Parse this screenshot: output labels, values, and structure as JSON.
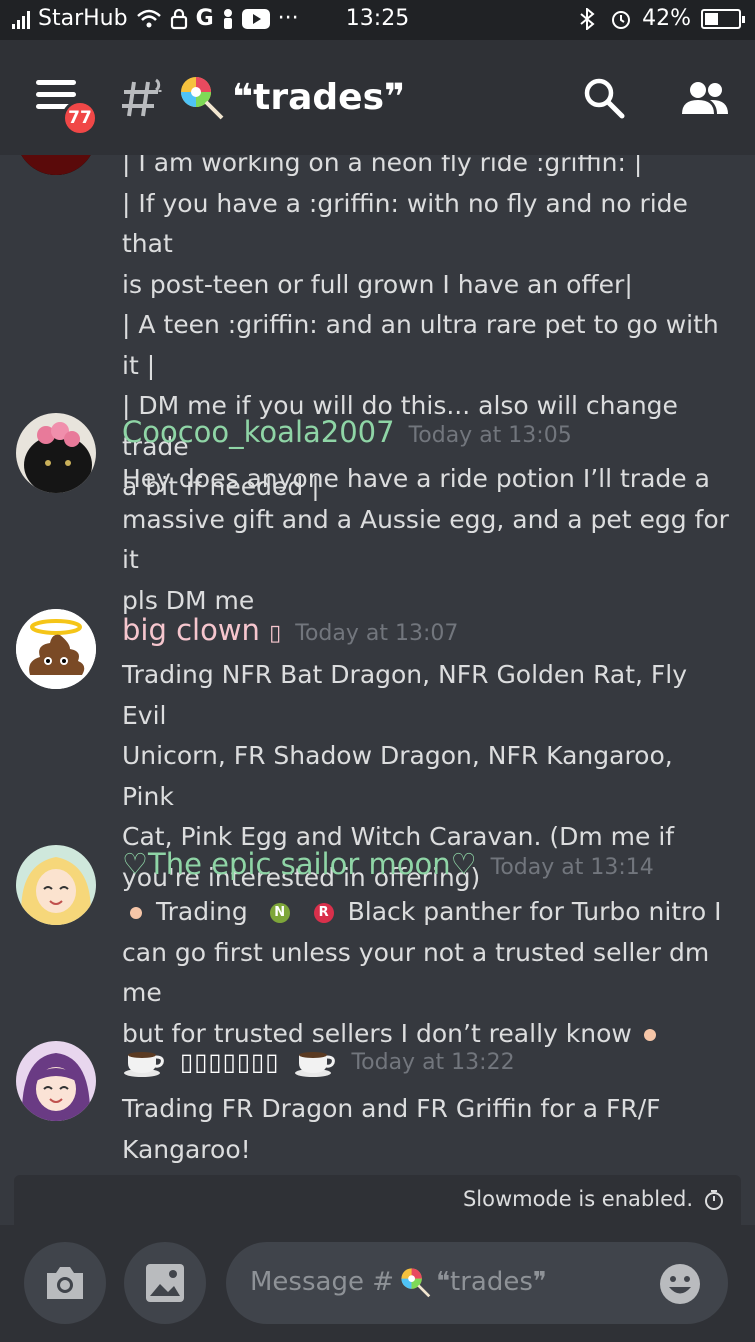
{
  "status_bar": {
    "carrier": "StarHub",
    "time": "13:25",
    "battery": "42%",
    "battery_level": 0.42
  },
  "header": {
    "notification_badge": "77",
    "channel_name": "❝trades❞",
    "channel_emoji": "lollipop-icon"
  },
  "messages": [
    {
      "continued": true,
      "lines": [
        "| I am working on a neon fly ride :griffin: |",
        "| If you have a :griffin: with no fly and no ride that",
        "is post-teen or full grown I have an offer|",
        "| A teen :griffin: and an ultra rare pet to go with it |",
        "| DM me if you will do this... also will change trade",
        "a bit if needed |"
      ]
    },
    {
      "username": "Coocoo_koala2007",
      "username_color": "#8fd5a6",
      "timestamp": "Today at 13:05",
      "lines": [
        "Hey does anyone have a ride potion I’ll trade a",
        "massive gift and a Aussie egg, and a pet egg for it",
        "pls DM me"
      ]
    },
    {
      "username": "big clown",
      "username_suffix": "▯",
      "username_color": "#f6c6ce",
      "timestamp": "Today at 13:07",
      "lines": [
        "Trading NFR Bat Dragon, NFR Golden Rat, Fly Evil",
        "Unicorn, FR Shadow Dragon, NFR Kangaroo, Pink",
        "Cat, Pink Egg and Witch Caravan. (Dm me if",
        "you're interested in offering)"
      ]
    },
    {
      "username": "♡The epic sailor moon♡",
      "username_color": "#8fd5a6",
      "timestamp": "Today at 13:14",
      "line1_trading": "Trading",
      "line1_n": "N",
      "line1_r": "R",
      "line1_rest": "Black panther for Turbo nitro I",
      "lines": [
        "can go first unless your not a trusted seller dm me",
        "but for trusted sellers I don’t really know"
      ]
    },
    {
      "username": "▯▯▯▯▯▯▯",
      "username_color": "#ffffff",
      "timestamp": "Today at 13:22",
      "lines": [
        "Trading FR Dragon and FR Griffin for a FR/F",
        "Kangaroo!"
      ]
    }
  ],
  "slowmode": "Slowmode is enabled.",
  "composer": {
    "placeholder_prefix": "Message #",
    "placeholder_channel": "❝trades❞"
  }
}
